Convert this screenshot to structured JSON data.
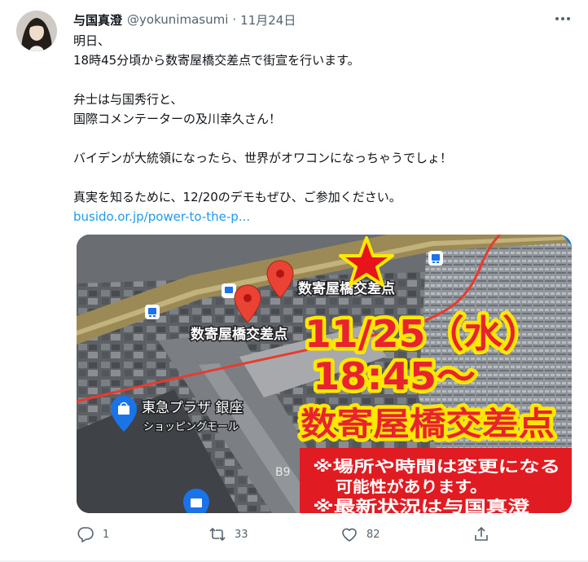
{
  "tweet": {
    "author_name": "与国真澄",
    "handle": "@yokunimasumi",
    "separator": "·",
    "date": "11月24日",
    "lines": [
      "明日、",
      "18時45分頃から数寄屋橋交差点で街宣を行います。",
      "弁士は与国秀行と、",
      "国際コメンテーターの及川幸久さん！",
      "バイデンが大統領になったら、世界がオワコンになっちゃうでしょ！",
      "真実を知るために、12/20のデモもぜひ、ご参加ください。"
    ],
    "link": "busido.or.jp/power-to-the-p..."
  },
  "media": {
    "map_label_1": "数寄屋橋交差点",
    "map_label_2": "数寄屋橋交差点",
    "store_name": "東急プラザ 銀座",
    "store_sub": "ショッピングモール",
    "road_label": "B9",
    "overlay_date": "11/25（水）",
    "overlay_time": "18:45～",
    "overlay_place": "数寄屋橋交差点",
    "notice_1": "※場所や時間は変更になる",
    "notice_2": "可能性があります。",
    "notice_3": "※最新状況は与国真澄"
  },
  "actions": {
    "reply_count": "1",
    "retweet_count": "33",
    "like_count": "82"
  },
  "colors": {
    "link": "#1d9bf0",
    "muted": "#536471",
    "overlay_text": "#e8232f",
    "overlay_outline": "#ffe800",
    "notice_bg": "#e01b22",
    "star": "#e8141c"
  }
}
